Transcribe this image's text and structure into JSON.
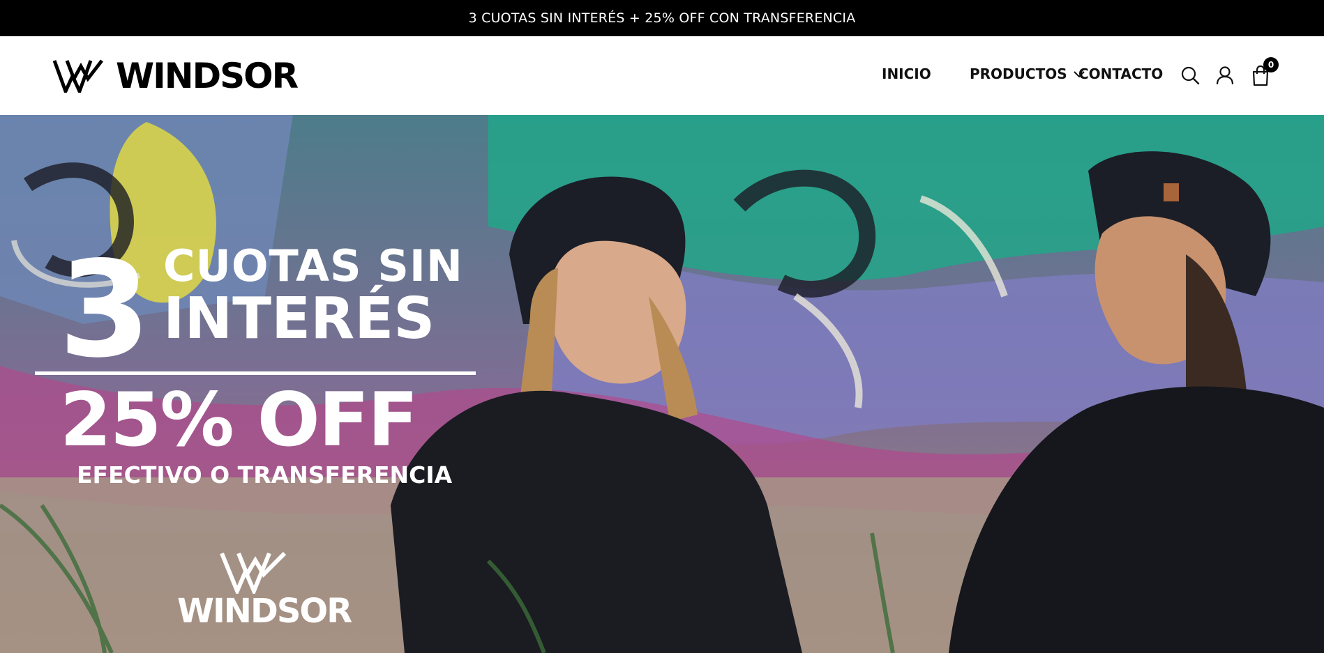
{
  "promo_bar": {
    "text": "3 CUOTAS SIN INTERÉS + 25% OFF CON TRANSFERENCIA"
  },
  "header": {
    "logo_text": "WINDSOR",
    "nav": {
      "inicio": "INICIO",
      "productos": "PRODUCTOS",
      "contacto": "CONTACTO"
    },
    "icons": {
      "search": "search-icon",
      "account": "user-icon",
      "cart": "shopping-bag-icon",
      "dropdown": "chevron-down-icon"
    },
    "cart_count": "0"
  },
  "hero": {
    "number": "3",
    "line1": "CUOTAS SIN",
    "line2": "INTERÉS",
    "line3": "25% OFF",
    "line4": "EFECTIVO O TRANSFERENCIA",
    "logo_text": "WINDSOR"
  },
  "colors": {
    "promo_bg": "#000000",
    "header_bg": "#ffffff",
    "text_primary": "#111111",
    "hero_text": "#ffffff"
  }
}
